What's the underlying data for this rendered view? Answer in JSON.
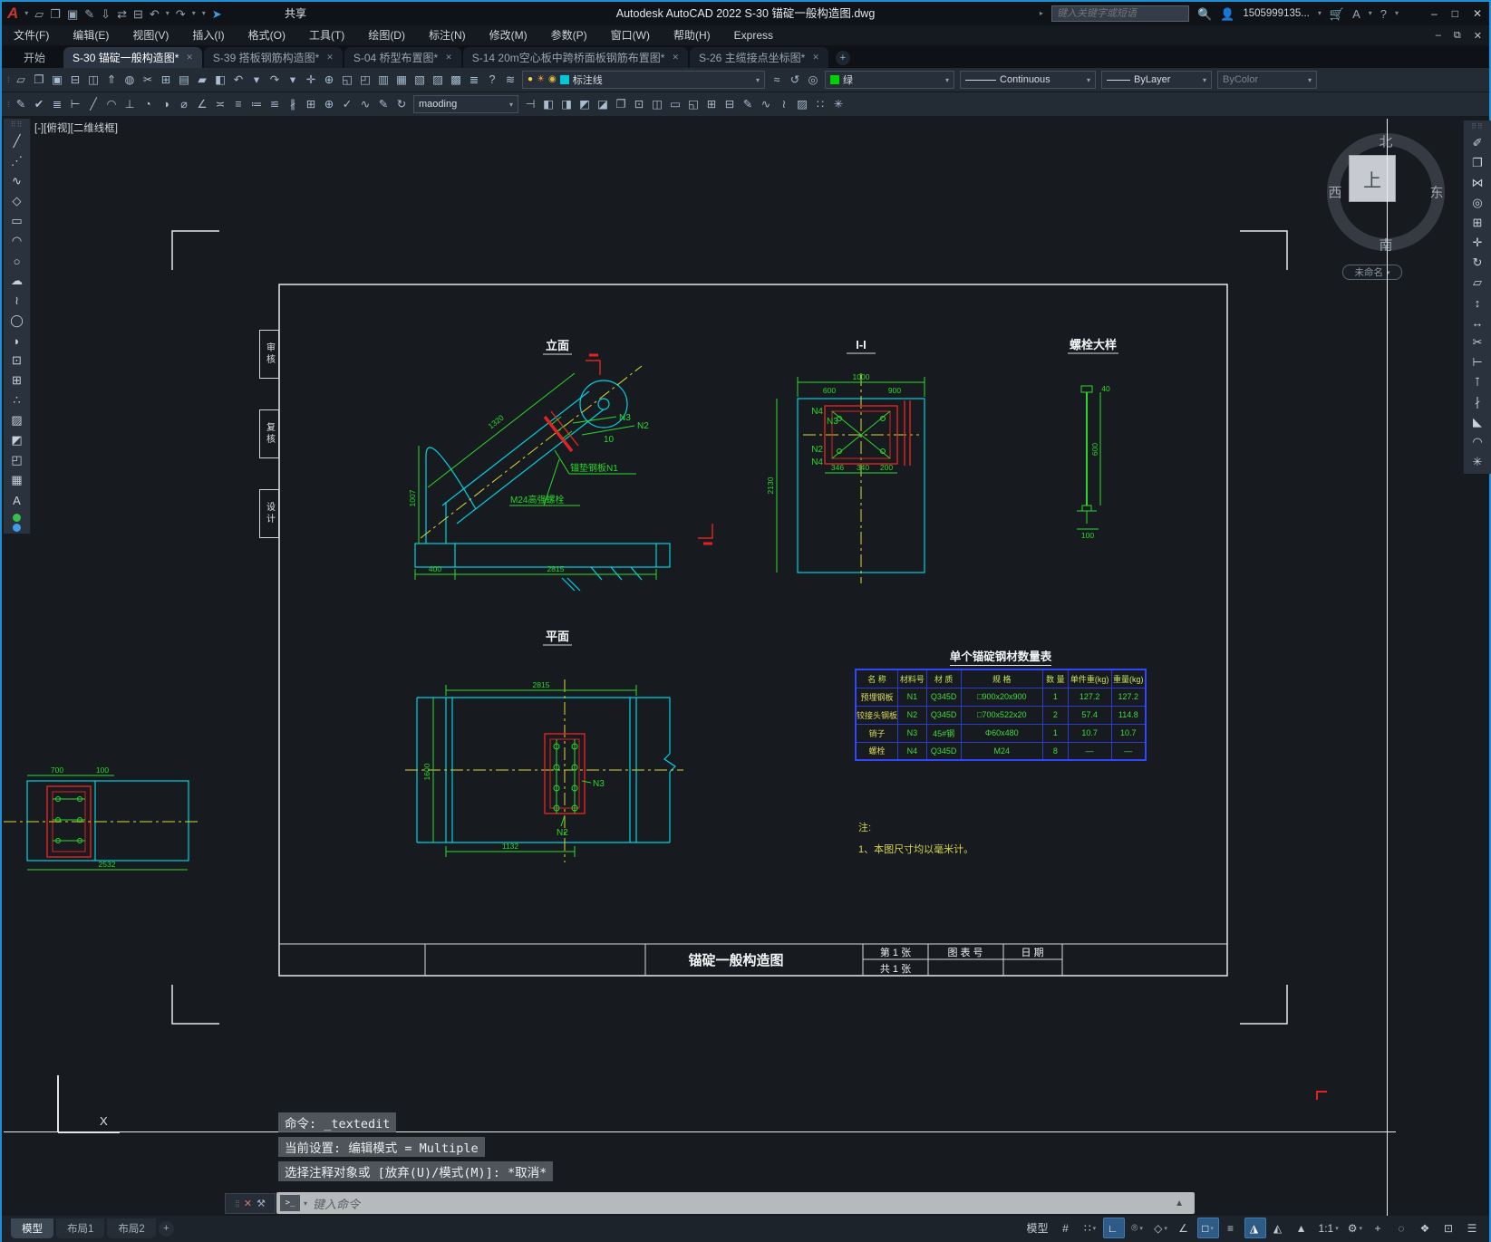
{
  "window": {
    "app_title": "Autodesk AutoCAD 2022    S-30 锚碇一般构造图.dwg",
    "share_label": "共享",
    "search_placeholder": "键入关键字或短语",
    "user_id": "1505999135...",
    "help_label": "?",
    "min": "–",
    "max": "□",
    "close": "✕",
    "doc_min": "–",
    "doc_restore": "⧉",
    "doc_close": "✕"
  },
  "menubar": {
    "items": [
      {
        "label": "文件(F)"
      },
      {
        "label": "编辑(E)"
      },
      {
        "label": "视图(V)"
      },
      {
        "label": "插入(I)"
      },
      {
        "label": "格式(O)"
      },
      {
        "label": "工具(T)"
      },
      {
        "label": "绘图(D)"
      },
      {
        "label": "标注(N)"
      },
      {
        "label": "修改(M)"
      },
      {
        "label": "参数(P)"
      },
      {
        "label": "窗口(W)"
      },
      {
        "label": "帮助(H)"
      },
      {
        "label": "Express"
      }
    ]
  },
  "tabbar": {
    "items": [
      {
        "label": "开始",
        "close": "",
        "cls": "start"
      },
      {
        "label": "S-30 锚碇一般构造图*",
        "close": "✕",
        "cls": "active"
      },
      {
        "label": "S-39 搭板钢筋构造图*",
        "close": "✕",
        "cls": ""
      },
      {
        "label": "S-04 桥型布置图*",
        "close": "✕",
        "cls": ""
      },
      {
        "label": "S-14 20m空心板中跨桥面板钢筋布置图*",
        "close": "✕",
        "cls": ""
      },
      {
        "label": "S-26 主缆接点坐标图*",
        "close": "✕",
        "cls": ""
      }
    ],
    "new_tab": "+"
  },
  "qat": {
    "icons": [
      {
        "n": "new-file-icon",
        "g": "▱"
      },
      {
        "n": "open-file-icon",
        "g": "❐"
      },
      {
        "n": "save-icon",
        "g": "▣"
      },
      {
        "n": "save-as-icon",
        "g": "✎"
      },
      {
        "n": "plot-stamp-icon",
        "g": "⇩"
      },
      {
        "n": "transfer-icon",
        "g": "⇄"
      },
      {
        "n": "print-icon",
        "g": "⊟"
      },
      {
        "n": "undo-icon",
        "g": "↶"
      },
      {
        "n": "undo-caret-icon",
        "g": "▾",
        "cls": "small"
      },
      {
        "n": "redo-icon",
        "g": "↷"
      },
      {
        "n": "redo-caret-icon",
        "g": "▾",
        "cls": "small"
      },
      {
        "n": "qat-customize-icon",
        "g": "▾",
        "cls": "small"
      },
      {
        "n": "share-icon",
        "g": "➤",
        "cls": "blue"
      }
    ]
  },
  "toolbar1": {
    "icons": [
      {
        "n": "new-icon",
        "g": "▱"
      },
      {
        "n": "open-icon",
        "g": "❐"
      },
      {
        "n": "save-icon",
        "g": "▣"
      },
      {
        "n": "plot-icon",
        "g": "⊟"
      },
      {
        "n": "plot-preview-icon",
        "g": "◫"
      },
      {
        "n": "publish-icon",
        "g": "⇑"
      },
      {
        "n": "web-icon",
        "g": "◍"
      },
      {
        "n": "cut-icon",
        "g": "✂"
      },
      {
        "n": "copy-clip-icon",
        "g": "⊞"
      },
      {
        "n": "paste-icon",
        "g": "▤"
      },
      {
        "n": "match-properties-icon",
        "g": "▰"
      },
      {
        "n": "block-editor-icon",
        "g": "◧"
      },
      {
        "n": "undo-icon",
        "g": "↶"
      },
      {
        "n": "undo-caret-icon",
        "g": "▾",
        "cls": "small"
      },
      {
        "n": "redo-icon",
        "g": "↷"
      },
      {
        "n": "redo-caret-icon",
        "g": "▾",
        "cls": "small"
      },
      {
        "n": "pan-icon",
        "g": "✛"
      },
      {
        "n": "zoom-realtime-icon",
        "g": "⊕"
      },
      {
        "n": "zoom-window-icon",
        "g": "◱"
      },
      {
        "n": "zoom-previous-icon",
        "g": "◰"
      },
      {
        "n": "properties-icon",
        "g": "▥"
      },
      {
        "n": "design-center-icon",
        "g": "▦"
      },
      {
        "n": "tool-palettes-icon",
        "g": "▧"
      },
      {
        "n": "sheet-set-icon",
        "g": "▨"
      },
      {
        "n": "markup-icon",
        "g": "▩"
      },
      {
        "n": "quickcalc-icon",
        "g": "≣"
      },
      {
        "n": "help-icon",
        "g": "?"
      }
    ],
    "layer_icon": {
      "n": "layer-properties-icon",
      "g": "≋"
    },
    "layer": {
      "value": "标注线",
      "chip_color": "#00c8d7",
      "bulb": "●",
      "sun": "☀",
      "lock": "◉"
    },
    "mid_icons": [
      {
        "n": "layer-states-icon",
        "g": "≈"
      },
      {
        "n": "layer-previous-icon",
        "g": "↺"
      },
      {
        "n": "layer-isolate-icon",
        "g": "◎"
      }
    ],
    "color": {
      "value": "绿",
      "chip_color": "#00d400"
    },
    "linetype": {
      "value": "Continuous"
    },
    "lineweight": {
      "value": "ByLayer"
    },
    "plotstyle": {
      "value": "ByColor"
    }
  },
  "toolbar2": {
    "style_icons": [
      {
        "n": "text-edit-icon",
        "g": "✎"
      },
      {
        "n": "text-check-icon",
        "g": "✔"
      },
      {
        "n": "text-layers-icon",
        "g": "≣"
      }
    ],
    "dim_icons": [
      {
        "n": "dim-linear-icon",
        "g": "⊢"
      },
      {
        "n": "dim-aligned-icon",
        "g": "╱"
      },
      {
        "n": "dim-arc-icon",
        "g": "◠"
      },
      {
        "n": "dim-ordinate-icon",
        "g": "⊥"
      },
      {
        "n": "dim-radius-icon",
        "g": "◔"
      },
      {
        "n": "dim-jogged-icon",
        "g": "◑"
      },
      {
        "n": "dim-diameter-icon",
        "g": "⌀"
      },
      {
        "n": "dim-angular-icon",
        "g": "∠"
      },
      {
        "n": "dim-quick-icon",
        "g": "≍"
      },
      {
        "n": "dim-baseline-icon",
        "g": "≡"
      },
      {
        "n": "dim-continue-icon",
        "g": "≔"
      },
      {
        "n": "dim-space-icon",
        "g": "≌"
      },
      {
        "n": "dim-break-icon",
        "g": "∦"
      },
      {
        "n": "tolerance-icon",
        "g": "⊞"
      },
      {
        "n": "center-mark-icon",
        "g": "⊕"
      },
      {
        "n": "dim-inspect-icon",
        "g": "✓"
      },
      {
        "n": "dim-jogline-icon",
        "g": "∿"
      },
      {
        "n": "dim-edit-icon",
        "g": "✎"
      },
      {
        "n": "dim-update-icon",
        "g": "↻"
      }
    ],
    "textstyle": {
      "value": "maoding"
    },
    "apply_icon": {
      "n": "dim-style-apply-icon",
      "g": "⊣"
    },
    "modify_icons": [
      {
        "n": "draw-order-front-icon",
        "g": "◧"
      },
      {
        "n": "draw-order-back-icon",
        "g": "◨"
      },
      {
        "n": "draw-order-above-icon",
        "g": "◩"
      },
      {
        "n": "draw-order-below-icon",
        "g": "◪"
      },
      {
        "n": "copy-nested-icon",
        "g": "❐"
      },
      {
        "n": "xref-open-icon",
        "g": "⊡"
      },
      {
        "n": "xref-clip-icon",
        "g": "◫"
      },
      {
        "n": "image-frame-icon",
        "g": "▭"
      },
      {
        "n": "viewport-clip-icon",
        "g": "◱"
      },
      {
        "n": "group-icon",
        "g": "⊞"
      },
      {
        "n": "ungroup-icon",
        "g": "⊟"
      },
      {
        "n": "group-edit-icon",
        "g": "✎"
      },
      {
        "n": "polyline-edit-icon",
        "g": "∿"
      },
      {
        "n": "spline-edit-icon",
        "g": "≀"
      },
      {
        "n": "hatch-edit-icon",
        "g": "▨"
      },
      {
        "n": "array-edit-icon",
        "g": "∷"
      },
      {
        "n": "explode-icon",
        "g": "✳"
      }
    ]
  },
  "left_palette": {
    "icons": [
      {
        "n": "line-icon",
        "g": "╱"
      },
      {
        "n": "construction-line-icon",
        "g": "⋰"
      },
      {
        "n": "polyline-icon",
        "g": "∿"
      },
      {
        "n": "polygon-icon",
        "g": "◇"
      },
      {
        "n": "rectangle-icon",
        "g": "▭"
      },
      {
        "n": "arc-icon",
        "g": "◠"
      },
      {
        "n": "circle-icon",
        "g": "○"
      },
      {
        "n": "revision-cloud-icon",
        "g": "☁"
      },
      {
        "n": "spline-icon",
        "g": "≀"
      },
      {
        "n": "ellipse-icon",
        "g": "◯"
      },
      {
        "n": "ellipse-arc-icon",
        "g": "◗"
      },
      {
        "n": "insert-block-icon",
        "g": "⊡"
      },
      {
        "n": "create-block-icon",
        "g": "⊞"
      },
      {
        "n": "point-icon",
        "g": "∴"
      },
      {
        "n": "hatch-icon",
        "g": "▨"
      },
      {
        "n": "gradient-icon",
        "g": "◩"
      },
      {
        "n": "region-icon",
        "g": "◰"
      },
      {
        "n": "table-icon",
        "g": "▦"
      },
      {
        "n": "text-icon",
        "g": "A"
      }
    ]
  },
  "right_palette": {
    "icons": [
      {
        "n": "erase-icon",
        "g": "✐",
        "cls": "pink"
      },
      {
        "n": "copy-icon",
        "g": "❐"
      },
      {
        "n": "mirror-icon",
        "g": "⋈"
      },
      {
        "n": "offset-icon",
        "g": "◎"
      },
      {
        "n": "array-icon",
        "g": "⊞"
      },
      {
        "n": "move-icon",
        "g": "✛"
      },
      {
        "n": "rotate-icon",
        "g": "↻"
      },
      {
        "n": "scale-icon",
        "g": "▱"
      },
      {
        "n": "stretch-icon",
        "g": "↕"
      },
      {
        "n": "lengthen-icon",
        "g": "↔"
      },
      {
        "n": "trim-icon",
        "g": "✂"
      },
      {
        "n": "extend-icon",
        "g": "⊢"
      },
      {
        "n": "break-at-point-icon",
        "g": "⊺"
      },
      {
        "n": "break-icon",
        "g": "∤"
      },
      {
        "n": "chamfer-icon",
        "g": "◣"
      },
      {
        "n": "fillet-icon",
        "g": "◠"
      },
      {
        "n": "explode-icon",
        "g": "✳"
      }
    ]
  },
  "viewport": {
    "label": "[-][俯视][二维线框]"
  },
  "viewcube": {
    "north": "北",
    "south": "南",
    "west": "西",
    "east": "东",
    "top": "上",
    "pill": "未命名"
  },
  "command": {
    "history": [
      {
        "text": "命令: _textedit"
      },
      {
        "text": "当前设置: 编辑模式 = Multiple"
      },
      {
        "text": "选择注释对象或 [放弃(U)/模式(M)]: *取消*"
      }
    ],
    "prompt_glyph": ">_",
    "placeholder": "键入命令"
  },
  "layout_tabs": {
    "items": [
      {
        "label": "模型",
        "cls": "active"
      },
      {
        "label": "布局1",
        "cls": ""
      },
      {
        "label": "布局2",
        "cls": ""
      }
    ],
    "new_tab": "+"
  },
  "statusbar": {
    "items": [
      {
        "n": "model-space-toggle",
        "g": "模型",
        "cls": "",
        "caret": ""
      },
      {
        "n": "grid-display-toggle",
        "g": "#",
        "cls": "",
        "caret": ""
      },
      {
        "n": "snap-mode-toggle",
        "g": "∷",
        "cls": "",
        "caret": "▾"
      },
      {
        "n": "ortho-mode-toggle",
        "g": "∟",
        "cls": "on",
        "caret": ""
      },
      {
        "n": "polar-tracking-toggle",
        "g": "⌾",
        "cls": "",
        "caret": "▾"
      },
      {
        "n": "isometric-drafting-toggle",
        "g": "◇",
        "cls": "",
        "caret": "▾"
      },
      {
        "n": "object-snap-tracking-toggle",
        "g": "∠",
        "cls": "",
        "caret": ""
      },
      {
        "n": "object-snap-toggle",
        "g": "□",
        "cls": "on",
        "caret": "▾"
      },
      {
        "n": "lineweight-toggle",
        "g": "≡",
        "cls": "",
        "caret": ""
      },
      {
        "n": "annotation-visibility-toggle",
        "g": "◮",
        "cls": "on",
        "caret": ""
      },
      {
        "n": "annotation-autoscale-toggle",
        "g": "◭",
        "cls": "",
        "caret": ""
      },
      {
        "n": "annotation-scale-icon",
        "g": "▲",
        "cls": "",
        "caret": ""
      },
      {
        "n": "annotation-scale-value",
        "g": "1:1",
        "cls": "",
        "caret": "▾"
      },
      {
        "n": "workspace-switch",
        "g": "⚙",
        "cls": "",
        "caret": "▾"
      },
      {
        "n": "customize-button",
        "g": "+",
        "cls": "",
        "caret": ""
      },
      {
        "n": "isolate-objects-button",
        "g": "◌",
        "cls": "",
        "caret": ""
      },
      {
        "n": "graphics-performance-button",
        "g": "❖",
        "cls": "",
        "caret": ""
      },
      {
        "n": "clean-screen-button",
        "g": "⊡",
        "cls": "",
        "caret": ""
      },
      {
        "n": "status-menu-button",
        "g": "☰",
        "cls": "",
        "caret": ""
      }
    ]
  },
  "drawing": {
    "titles": {
      "elevation": "立面",
      "section": "I-I",
      "bolt_detail": "螺栓大样",
      "plan": "平面"
    },
    "stubs": [
      {
        "label": "审核"
      },
      {
        "label": "复核"
      },
      {
        "label": "设计"
      }
    ],
    "labels": {
      "n1": "锚垫钢板N1",
      "bolt": "M24高强螺栓",
      "n2": "N2",
      "n3": "N3",
      "n4": "N4",
      "ten": "10",
      "ucs_x": "X"
    },
    "dims": {
      "elev_diag": "1320",
      "elev_left": "1007",
      "elev_base_left": "400",
      "elev_base": "2815",
      "sec_top": "1000",
      "sec_top_l": "600",
      "sec_top_r": "900",
      "sec_left": "2130",
      "sec_b1": "346",
      "sec_b2": "340",
      "sec_b3": "200",
      "bolt_top": "40",
      "bolt_side": "600",
      "bolt_bottom": "100",
      "plan_top": "2815",
      "plan_bottom": "1132",
      "plan_left": "1600",
      "frag_d1": "700",
      "frag_d2": "100",
      "frag_bottom": "2532"
    },
    "table": {
      "title": "单个锚碇钢材数量表",
      "headers": [
        "名 称",
        "材料号",
        "材 质",
        "规 格",
        "数 量",
        "单件重(kg)",
        "重量(kg)"
      ],
      "rows": [
        {
          "c0": "预埋钢板",
          "c1": "N1",
          "c2": "Q345D",
          "c3": "□900x20x900",
          "c4": "1",
          "c5": "127.2",
          "c6": "127.2"
        },
        {
          "c0": "铰接头钢板",
          "c1": "N2",
          "c2": "Q345D",
          "c3": "□700x522x20",
          "c4": "2",
          "c5": "57.4",
          "c6": "114.8"
        },
        {
          "c0": "销子",
          "c1": "N3",
          "c2": "45#钢",
          "c3": "Φ60x480",
          "c4": "1",
          "c5": "10.7",
          "c6": "10.7"
        },
        {
          "c0": "螺栓",
          "c1": "N4",
          "c2": "Q345D",
          "c3": "M24",
          "c4": "8",
          "c5": "—",
          "c6": "—"
        }
      ]
    },
    "notes": {
      "head": "注:",
      "line1": "1、本图尺寸均以毫米计。"
    },
    "titleblock": {
      "name": "锚碇一般构造图",
      "sheet": "第 1 张",
      "total": "共 1 张",
      "chart_no": "图 表 号",
      "date": "日 期"
    }
  }
}
